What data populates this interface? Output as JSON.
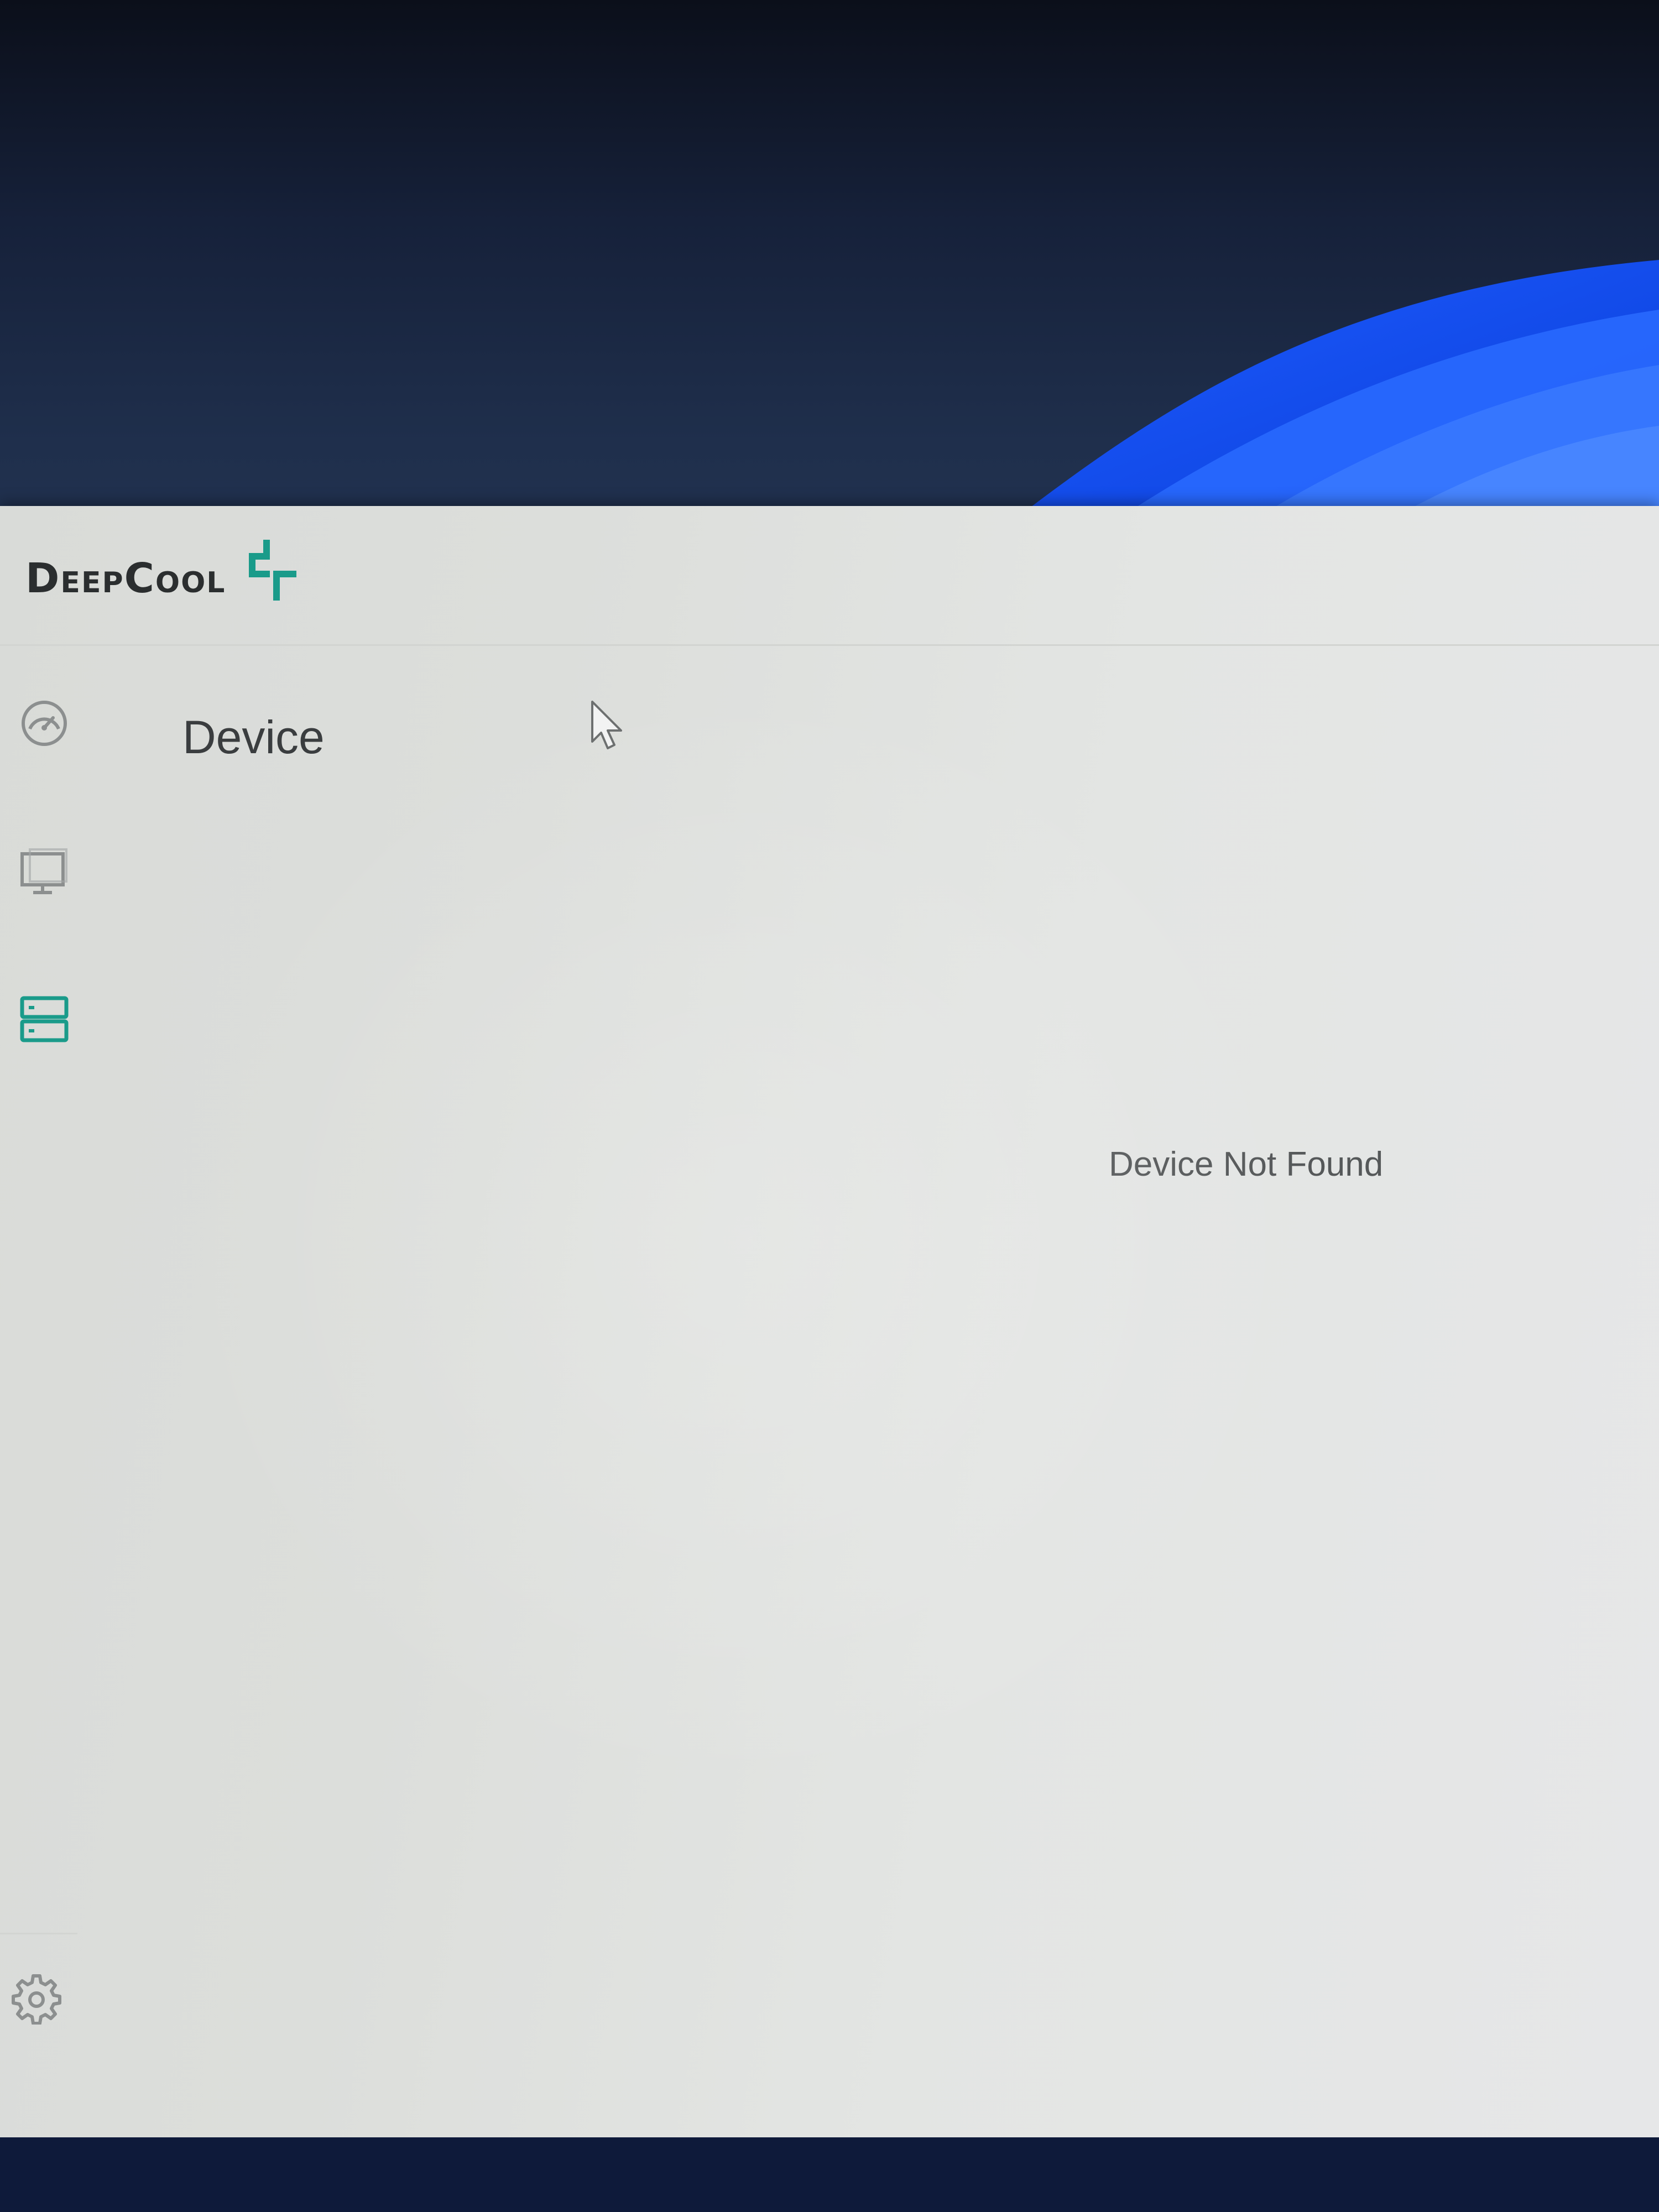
{
  "app": {
    "brand_name": "DeepCool",
    "accent_color": "#1a9b8a",
    "icon_color": "#8c8f8f"
  },
  "sidebar": {
    "items": [
      {
        "id": "dashboard",
        "icon": "speedometer-icon",
        "selected": false
      },
      {
        "id": "monitor",
        "icon": "monitor-icon",
        "selected": false
      },
      {
        "id": "device",
        "icon": "device-list-icon",
        "selected": true
      }
    ],
    "footer": {
      "icon": "gear-icon"
    }
  },
  "main": {
    "page_title": "Device",
    "empty_message": "Device Not Found"
  }
}
